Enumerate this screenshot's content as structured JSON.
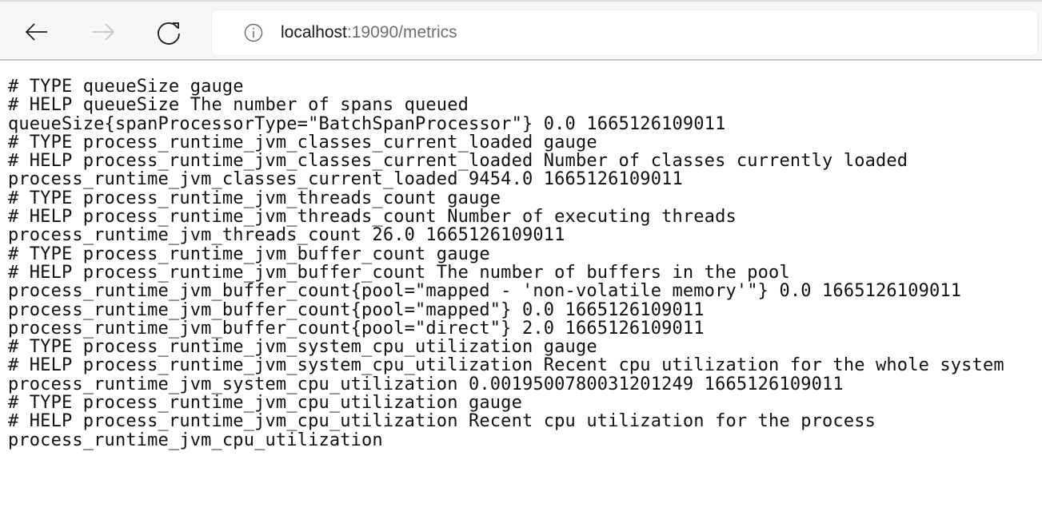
{
  "browser": {
    "nav": {
      "back_icon": "arrow-left-icon",
      "forward_icon": "arrow-right-icon",
      "reload_icon": "reload-icon",
      "forward_enabled": false
    },
    "address_bar": {
      "site_info_icon": "info-circle-icon",
      "url_host": "localhost",
      "url_rest": ":19090/metrics"
    }
  },
  "page": {
    "lines": [
      "# TYPE queueSize gauge",
      "# HELP queueSize The number of spans queued",
      "queueSize{spanProcessorType=\"BatchSpanProcessor\"} 0.0 1665126109011",
      "# TYPE process_runtime_jvm_classes_current_loaded gauge",
      "# HELP process_runtime_jvm_classes_current_loaded Number of classes currently loaded",
      "process_runtime_jvm_classes_current_loaded 9454.0 1665126109011",
      "# TYPE process_runtime_jvm_threads_count gauge",
      "# HELP process_runtime_jvm_threads_count Number of executing threads",
      "process_runtime_jvm_threads_count 26.0 1665126109011",
      "# TYPE process_runtime_jvm_buffer_count gauge",
      "# HELP process_runtime_jvm_buffer_count The number of buffers in the pool",
      "process_runtime_jvm_buffer_count{pool=\"mapped - 'non-volatile memory'\"} 0.0 1665126109011",
      "process_runtime_jvm_buffer_count{pool=\"mapped\"} 0.0 1665126109011",
      "process_runtime_jvm_buffer_count{pool=\"direct\"} 2.0 1665126109011",
      "# TYPE process_runtime_jvm_system_cpu_utilization gauge",
      "# HELP process_runtime_jvm_system_cpu_utilization Recent cpu utilization for the whole system",
      "process_runtime_jvm_system_cpu_utilization 0.0019500780031201249 1665126109011",
      "# TYPE process_runtime_jvm_cpu_utilization gauge",
      "# HELP process_runtime_jvm_cpu_utilization Recent cpu utilization for the process",
      "process_runtime_jvm_cpu_utilization"
    ]
  }
}
